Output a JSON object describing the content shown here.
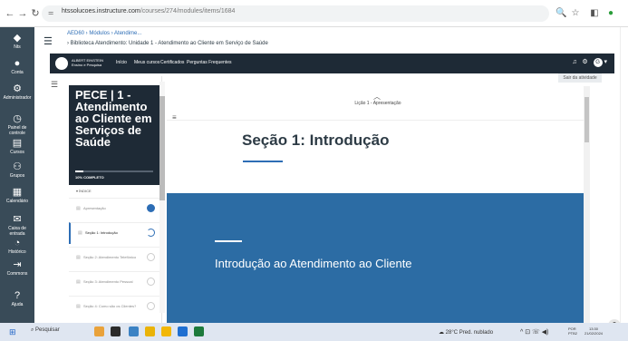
{
  "browser": {
    "url_domain": "htssolucoes.instructure.com",
    "url_path": "/courses/274/modules/items/1684",
    "back_icon": "arrow-left-icon",
    "forward_icon": "arrow-right-icon",
    "reload_icon": "reload-icon"
  },
  "globalnav": [
    {
      "label": "Nts",
      "icon": "logo-icon",
      "glyph": "◆"
    },
    {
      "label": "Conta",
      "icon": "avatar-icon",
      "glyph": "●"
    },
    {
      "label": "Administrador",
      "icon": "admin-icon",
      "glyph": "⚙"
    },
    {
      "label": "Painel de controle",
      "icon": "dashboard-icon",
      "glyph": "◷"
    },
    {
      "label": "Cursos",
      "icon": "courses-icon",
      "glyph": "▤"
    },
    {
      "label": "Grupos",
      "icon": "groups-icon",
      "glyph": "⚇"
    },
    {
      "label": "Calendário",
      "icon": "calendar-icon",
      "glyph": "▦"
    },
    {
      "label": "Caixa de entrada",
      "icon": "inbox-icon",
      "glyph": "✉"
    },
    {
      "label": "Histórico",
      "icon": "history-icon",
      "glyph": "◔"
    },
    {
      "label": "Commons",
      "icon": "commons-icon",
      "glyph": "⇥"
    },
    {
      "label": "Ajuda",
      "icon": "help-icon",
      "glyph": "?"
    }
  ],
  "breadcrumb": {
    "line1": "AED60 › Módulos › Atendime...",
    "line2": "› Biblioteca Atendimento: Unidade 1 - Atendimento ao Cliente em Serviço de Saúde"
  },
  "course_header": {
    "logo_text": "ALBERT EINSTEIN",
    "logo_sub": "Ensino e Pesquisa",
    "links": [
      "Início",
      "Meus cursos",
      "Certificados",
      "Perguntas Frequentes"
    ],
    "user_initial": "G"
  },
  "exit_button": "Sair da atividade",
  "sidebar": {
    "course_title": "PECE | 1 - Atendimento ao Cliente em Serviços de Saúde",
    "progress_text": "10% COMPLETO",
    "progress_percent": 10,
    "index_label": "▾ ÍNDICE",
    "lessons": [
      {
        "label": "Apresentação",
        "status": "done"
      },
      {
        "label": "Seção 1: Introdução",
        "status": "in-progress"
      },
      {
        "label": "Seção 2: Atendimento Telefônico",
        "status": "todo"
      },
      {
        "label": "Seção 3: Atendimento Pessoal",
        "status": "todo"
      },
      {
        "label": "Seção 4: Como são os Clientes?",
        "status": "todo"
      }
    ]
  },
  "content": {
    "lesson_label": "Lição 1 - Apresentação",
    "section_title": "Seção 1: Introdução",
    "hero_text": "Introdução ao Atendimento ao Cliente",
    "hero_color": "#2c6ca4"
  },
  "taskbar": {
    "search_placeholder": "Pesquisar",
    "weather": "28°C Pred. nublado",
    "lang": "POR PTB2",
    "time": "13:30",
    "date": "21/02/2024"
  }
}
